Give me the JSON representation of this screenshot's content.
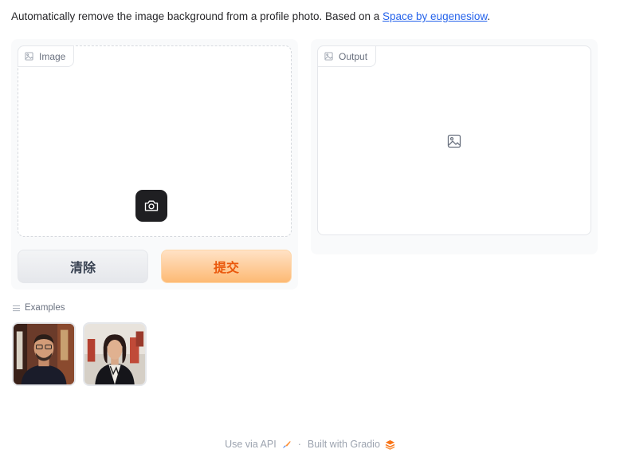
{
  "description": {
    "text": "Automatically remove the image background from a profile photo. Based on a ",
    "link_text": "Space by eugenesiow",
    "suffix": "."
  },
  "input_image": {
    "label": "Image",
    "label_icon": "image-icon",
    "webcam_icon": "camera-icon"
  },
  "output_image": {
    "label": "Output",
    "label_icon": "image-icon",
    "placeholder_icon": "image-placeholder-icon"
  },
  "buttons": {
    "clear_label": "清除",
    "submit_label": "提交"
  },
  "examples": {
    "label": "Examples",
    "label_icon": "list-icon",
    "items": [
      {
        "icon": "portrait-man-thumbnail"
      },
      {
        "icon": "portrait-woman-thumbnail"
      }
    ]
  },
  "footer": {
    "api_label": "Use via API",
    "api_icon": "rocket-icon",
    "separator": "·",
    "built_label": "Built with Gradio",
    "built_icon": "gradio-logo-icon"
  },
  "colors": {
    "link": "#2563eb",
    "submit_bg": "#fdba74",
    "submit_text": "#ea580c",
    "clear_bg": "#e5e7eb",
    "panel_bg": "#f9fafb"
  }
}
